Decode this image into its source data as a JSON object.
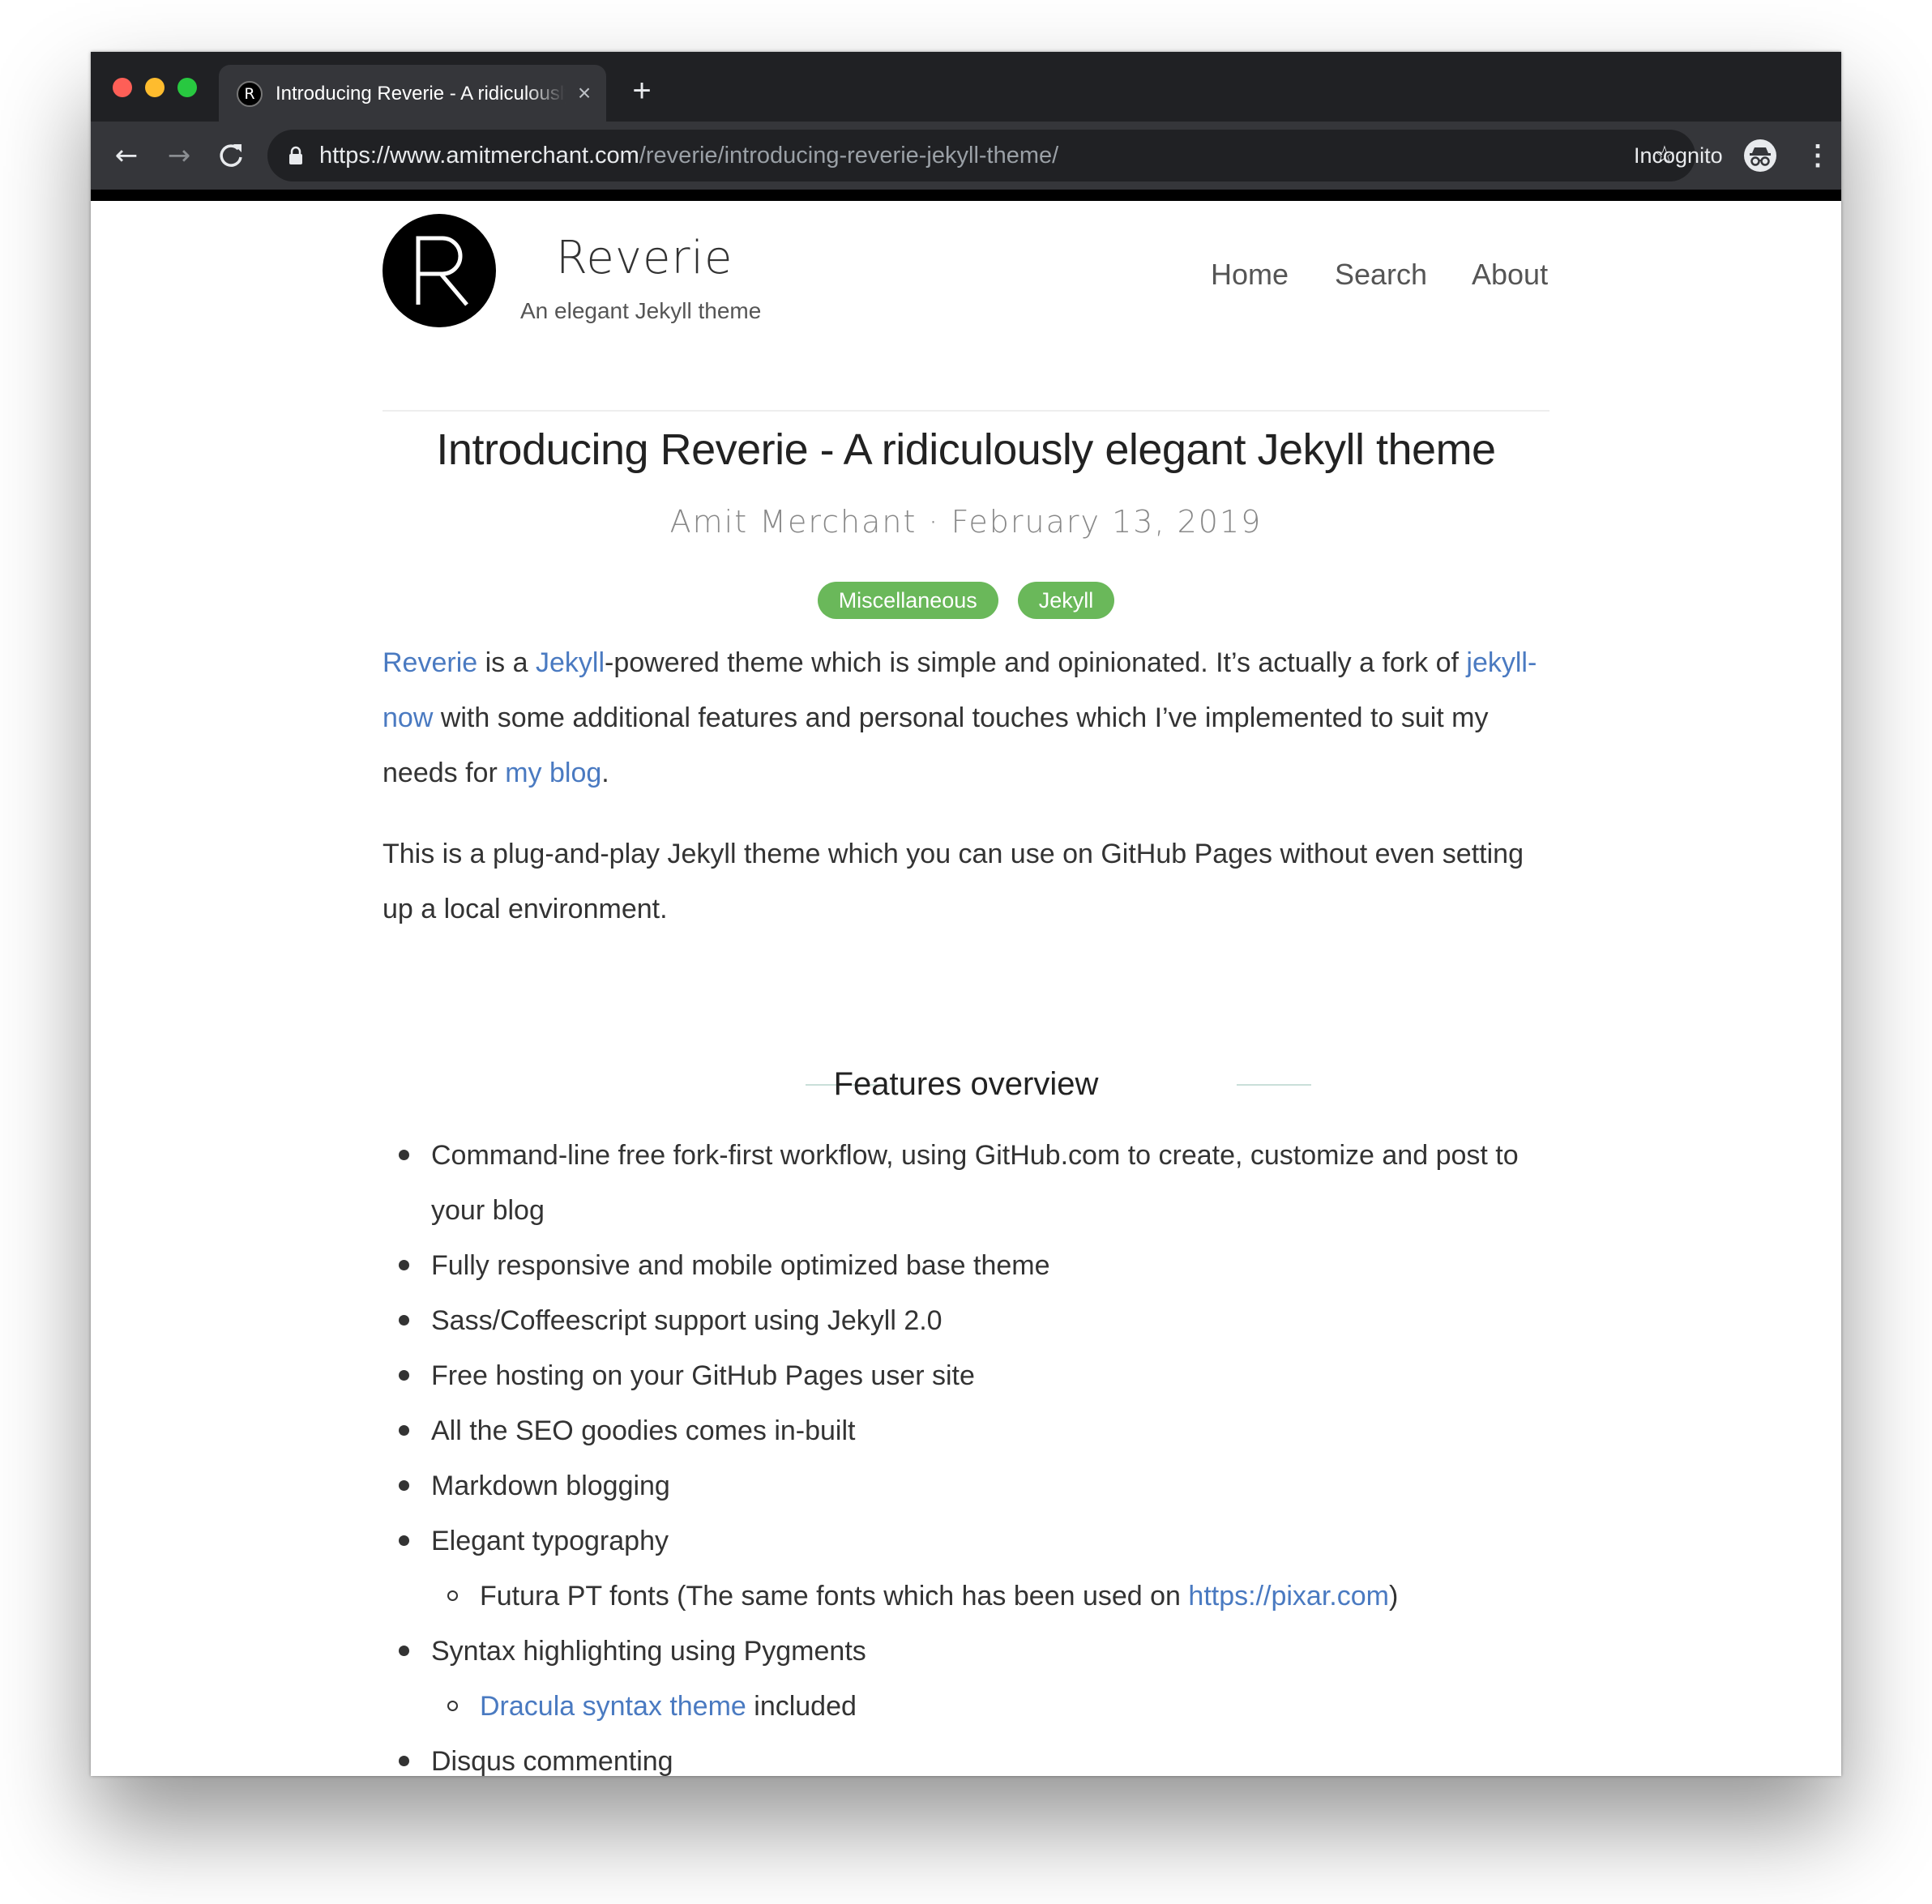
{
  "browser": {
    "tab_title": "Introducing Reverie - A ridiculously elegant Jekyll theme",
    "tab_favicon_letter": "R",
    "tab_close": "×",
    "new_tab": "+",
    "url_host": "https://www.amitmerchant.com",
    "url_path": "/reverie/introducing-reverie-jekyll-theme/",
    "incognito_label": "Incognito",
    "icons": [
      "back-arrow-icon",
      "forward-arrow-icon",
      "reload-icon",
      "lock-icon",
      "star-icon",
      "incognito-icon",
      "menu-icon",
      "close-icon",
      "plus-icon"
    ]
  },
  "site": {
    "name": "Reverie",
    "description": "An elegant Jekyll theme",
    "nav": [
      {
        "label": "Home"
      },
      {
        "label": "Search"
      },
      {
        "label": "About"
      }
    ]
  },
  "post": {
    "title": "Introducing Reverie - A ridiculously elegant Jekyll theme",
    "meta": "Amit Merchant · February 13, 2019",
    "tags": [
      "Miscellaneous",
      "Jekyll"
    ],
    "tag_color": "#6ab85a",
    "link_color": "#4a7ac1",
    "p1": {
      "link_reverie": "Reverie",
      "t1": " is a ",
      "link_jekyll": "Jekyll",
      "t2": "-powered theme which is simple and opinionated. It’s actually a fork of ",
      "link_jekyll_now": "jekyll-now",
      "t3": " with some additional features and personal touches which I’ve implemented to suit my needs for ",
      "link_my_blog": "my blog",
      "t4": "."
    },
    "p2": "This is a plug-and-play Jekyll theme which you can use on GitHub Pages without even setting up a local environment.",
    "features_heading": "Features overview",
    "features": {
      "f1": "Command-line free fork-first workflow, using GitHub.com to create, customize and post to your blog",
      "f2": "Fully responsive and mobile optimized base theme",
      "f3": "Sass/Coffeescript support using Jekyll 2.0",
      "f4": "Free hosting on your GitHub Pages user site",
      "f5": "All the SEO goodies comes in-built",
      "f6": "Markdown blogging",
      "f7": "Elegant typography",
      "f7_sub_text": "Futura PT fonts (The same fonts which has been used on ",
      "f7_sub_link": "https://pixar.com",
      "f7_sub_end": ")",
      "f8": "Syntax highlighting using Pygments",
      "f8_sub_link": "Dracula syntax theme",
      "f8_sub_text": " included",
      "f9": "Disqus commenting"
    }
  }
}
